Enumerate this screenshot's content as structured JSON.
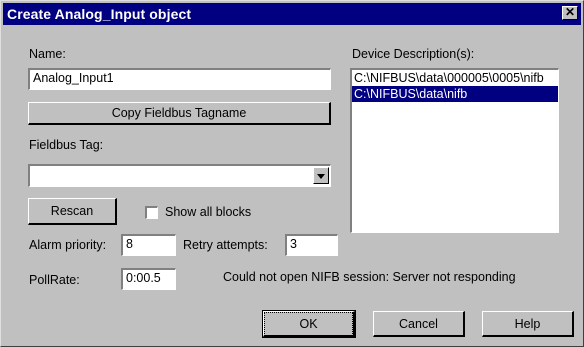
{
  "window": {
    "title": "Create Analog_Input object",
    "close_glyph": "✕"
  },
  "name": {
    "label": "Name:",
    "value": "Analog_Input1"
  },
  "copy_button": "Copy Fieldbus Tagname",
  "fieldbus_tag": {
    "label": "Fieldbus Tag:",
    "value": ""
  },
  "rescan_button": "Rescan",
  "show_all_blocks": {
    "label": "Show all blocks",
    "checked": false
  },
  "alarm_priority": {
    "label": "Alarm priority:",
    "value": "8"
  },
  "retry_attempts": {
    "label": "Retry attempts:",
    "value": "3"
  },
  "poll_rate": {
    "label": "PollRate:",
    "value": "0:00.5"
  },
  "status_message": "Could not open NIFB session: Server not responding",
  "device_descriptions": {
    "label": "Device Description(s):",
    "items": [
      "C:\\NIFBUS\\data\\000005\\0005\\nifb",
      "C:\\NIFBUS\\data\\nifb"
    ],
    "selected_index": 1
  },
  "buttons": {
    "ok": "OK",
    "cancel": "Cancel",
    "help": "Help"
  }
}
